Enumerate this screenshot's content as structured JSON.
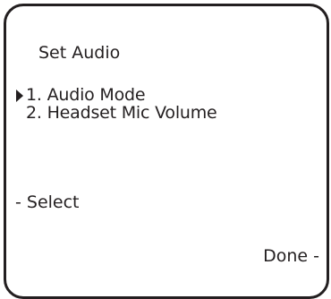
{
  "screen": {
    "title": "Set Audio",
    "menu": {
      "items": [
        {
          "label": "1. Audio Mode",
          "selected": true
        },
        {
          "label": "2. Headset Mic Volume",
          "selected": false
        }
      ]
    },
    "softkeys": {
      "left": "- Select",
      "right": "Done -"
    }
  }
}
